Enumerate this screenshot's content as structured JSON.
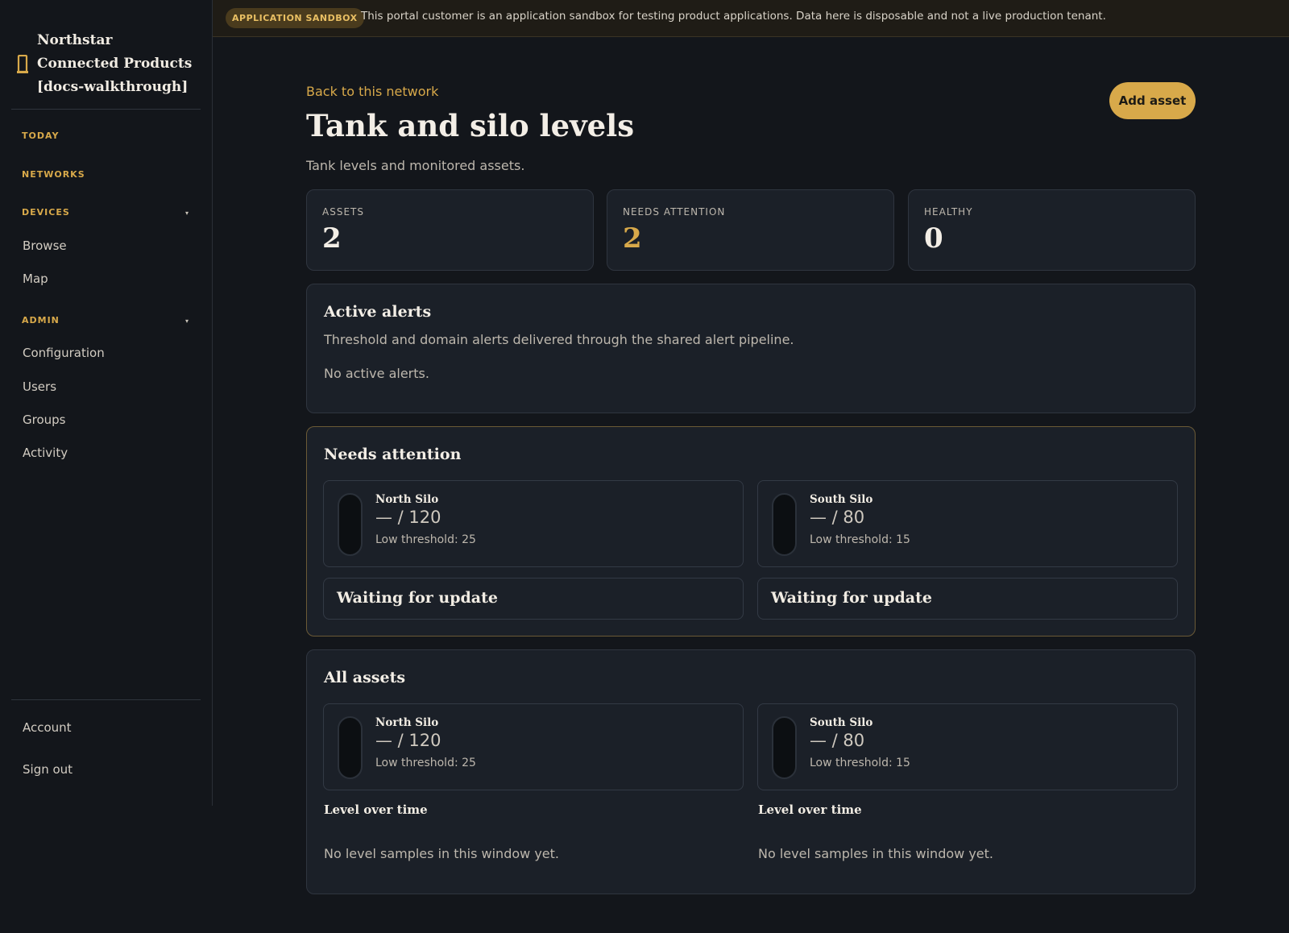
{
  "sidebar": {
    "brand": "Northstar Connected Products [docs-walkthrough]",
    "sections": {
      "today": "TODAY",
      "networks": "NETWORKS",
      "devices": "DEVICES",
      "admin": "ADMIN"
    },
    "devices_items": [
      "Browse",
      "Map"
    ],
    "admin_items": [
      "Configuration",
      "Users",
      "Groups",
      "Activity"
    ],
    "footer_items": [
      "Account",
      "Sign out"
    ],
    "caret": "▾"
  },
  "banner": {
    "badge": "APPLICATION SANDBOX",
    "text": "This portal customer is an application sandbox for testing product applications. Data here is disposable and not a live production tenant."
  },
  "page": {
    "back_link": "Back to this network",
    "title": "Tank and silo levels",
    "subtitle": "Tank levels and monitored assets.",
    "add_button": "Add asset"
  },
  "stats": [
    {
      "label": "ASSETS",
      "value": "2"
    },
    {
      "label": "NEEDS ATTENTION",
      "value": "2"
    },
    {
      "label": "HEALTHY",
      "value": "0"
    }
  ],
  "alerts": {
    "title": "Active alerts",
    "description": "Threshold and domain alerts delivered through the shared alert pipeline.",
    "empty": "No active alerts."
  },
  "needs_attention": {
    "title": "Needs attention",
    "assets": [
      {
        "name": "North Silo",
        "level": "— / 120",
        "threshold": "Low threshold: 25",
        "status": "Waiting for update"
      },
      {
        "name": "South Silo",
        "level": "— / 80",
        "threshold": "Low threshold: 15",
        "status": "Waiting for update"
      }
    ]
  },
  "all_assets": {
    "title": "All assets",
    "assets": [
      {
        "name": "North Silo",
        "level": "— / 120",
        "threshold": "Low threshold: 25",
        "chart_label": "Level over time",
        "chart_empty": "No level samples in this window yet."
      },
      {
        "name": "South Silo",
        "level": "— / 80",
        "threshold": "Low threshold: 15",
        "chart_label": "Level over time",
        "chart_empty": "No level samples in this window yet."
      }
    ]
  },
  "colors": {
    "accent": "#d8a94a",
    "background": "#13161b",
    "card": "#1b2028"
  }
}
